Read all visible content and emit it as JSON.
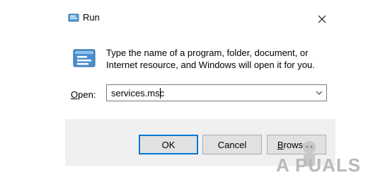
{
  "window": {
    "title": "Run",
    "close_icon": "close-icon"
  },
  "prompt": {
    "line1": "Type the name of a program, folder, document, or",
    "line2": "Internet resource, and Windows will open it for you."
  },
  "open": {
    "label_prefix": "O",
    "label_rest": "pen:",
    "value": "services.msc"
  },
  "buttons": {
    "ok": "OK",
    "cancel": "Cancel",
    "browse_prefix": "B",
    "browse_rest": "rowse..."
  },
  "watermark": {
    "text": "A  PUALS"
  },
  "colors": {
    "accent": "#0078d7",
    "footer_bg": "#f0f0f0",
    "button_bg": "#e1e1e1"
  }
}
